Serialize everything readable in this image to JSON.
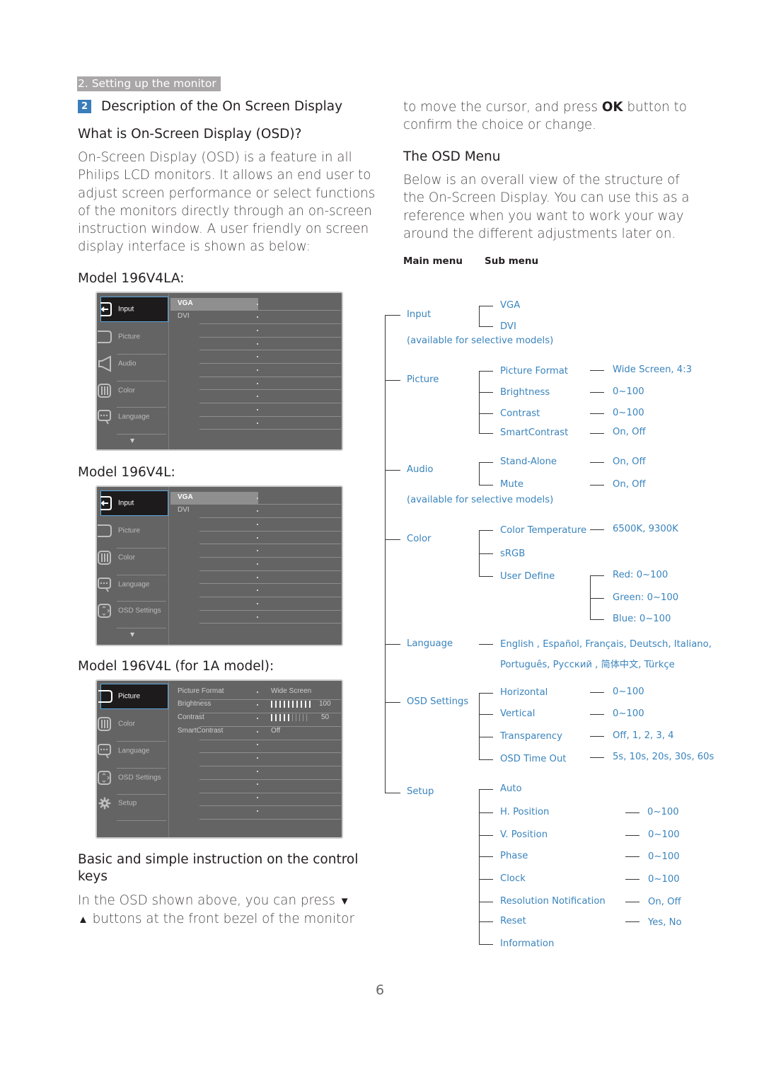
{
  "header": {
    "section_tag": "2. Setting up the monitor",
    "section_number": "2",
    "section_title": "Description of the On Screen Display"
  },
  "left": {
    "what_is_title": "What is On-Screen Display (OSD)?",
    "intro_lines": [
      "On-Screen Display (OSD) is a feature in all",
      "Philips LCD monitors. It allows an end user to",
      "adjust screen performance or select functions",
      "of the monitors directly through an on-screen",
      "instruction window. A user friendly on screen",
      "display interface is shown as below:"
    ],
    "models": [
      {
        "title": "Model 196V4LA:",
        "menu": [
          {
            "label": "Input",
            "icon": "input-icon",
            "active": true
          },
          {
            "label": "Picture",
            "icon": "picture-icon",
            "active": false
          },
          {
            "label": "Audio",
            "icon": "audio-icon",
            "active": false
          },
          {
            "label": "Color",
            "icon": "color-icon",
            "active": false
          },
          {
            "label": "Language",
            "icon": "language-icon",
            "active": false
          }
        ],
        "submenu": [
          "VGA",
          "DVI"
        ],
        "selected_sub": "VGA",
        "more_indicator": "▼"
      },
      {
        "title": "Model 196V4L:",
        "menu": [
          {
            "label": "Input",
            "icon": "input-icon",
            "active": true
          },
          {
            "label": "Picture",
            "icon": "picture-icon",
            "active": false
          },
          {
            "label": "Color",
            "icon": "color-icon",
            "active": false
          },
          {
            "label": "Language",
            "icon": "language-icon",
            "active": false
          },
          {
            "label": "OSD Settings",
            "icon": "osd-settings-icon",
            "active": false
          }
        ],
        "submenu": [
          "VGA",
          "DVI"
        ],
        "selected_sub": "VGA",
        "more_indicator": "▼"
      },
      {
        "title": "Model 196V4L (for 1A model):",
        "menu": [
          {
            "label": "Picture",
            "icon": "picture-icon",
            "active": true
          },
          {
            "label": "Color",
            "icon": "color-icon",
            "active": false
          },
          {
            "label": "Language",
            "icon": "language-icon",
            "active": false
          },
          {
            "label": "OSD Settings",
            "icon": "osd-settings-icon",
            "active": false
          },
          {
            "label": "Setup",
            "icon": "gear-icon",
            "active": false
          }
        ],
        "settings": [
          {
            "label": "Picture Format",
            "value": "Wide Screen"
          },
          {
            "label": "Brightness",
            "value": "100",
            "level": 1.0
          },
          {
            "label": "Contrast",
            "value": "50",
            "level": 0.5
          },
          {
            "label": "SmartContrast",
            "value": "Off"
          }
        ]
      }
    ],
    "control_keys_title_l1": "Basic and simple instruction on the control",
    "control_keys_title_l2": "keys",
    "control_keys_l1": "In the OSD shown above, you can press",
    "control_keys_l2": "buttons at the front bezel of the monitor",
    "down_symbol": "▼",
    "up_symbol": "▲"
  },
  "right": {
    "continue_l1_pre": "to move the cursor, and press ",
    "continue_l1_bold": "OK",
    "continue_l1_post": " button to",
    "continue_l2": "confirm the choice or change.",
    "osd_menu_title": "The OSD Menu",
    "osd_menu_lines": [
      "Below is an overall view of the structure of",
      "the On-Screen Display. You can use this as a",
      "reference when you want to work your way",
      "around the different adjustments later on."
    ],
    "col_main": "Main menu",
    "col_sub": "Sub menu",
    "tree": {
      "input": {
        "label": "Input",
        "subs": [
          "VGA",
          "DVI"
        ],
        "note": "(available for selective models)"
      },
      "picture": {
        "label": "Picture",
        "subs": [
          {
            "label": "Picture Format",
            "value": "Wide Screen, 4:3"
          },
          {
            "label": "Brightness",
            "value": "0~100"
          },
          {
            "label": "Contrast",
            "value": "0~100"
          },
          {
            "label": "SmartContrast",
            "value": "On, Off"
          }
        ]
      },
      "audio": {
        "label": "Audio",
        "subs": [
          {
            "label": "Stand-Alone",
            "value": "On, Off"
          },
          {
            "label": "Mute",
            "value": "On, Off"
          }
        ],
        "note": "(available for selective models)"
      },
      "color": {
        "label": "Color",
        "subs": [
          {
            "label": "Color Temperature",
            "value": "6500K, 9300K"
          },
          {
            "label": "sRGB"
          },
          {
            "label": "User Define",
            "values": [
              "Red: 0~100",
              "Green: 0~100",
              "Blue: 0~100"
            ]
          }
        ]
      },
      "language": {
        "label": "Language",
        "line1": "English , Español, Français, Deutsch, Italiano,",
        "line2": "Português, Русский , 简体中文, Türkçe"
      },
      "osd_settings": {
        "label": "OSD Settings",
        "subs": [
          {
            "label": "Horizontal",
            "value": "0~100"
          },
          {
            "label": "Vertical",
            "value": "0~100"
          },
          {
            "label": "Transparency",
            "value": "Off, 1, 2, 3, 4"
          },
          {
            "label": "OSD Time Out",
            "value": "5s, 10s, 20s, 30s, 60s"
          }
        ]
      },
      "setup": {
        "label": "Setup",
        "subs": [
          {
            "label": "Auto"
          },
          {
            "label": "H. Position",
            "value": "0~100"
          },
          {
            "label": "V. Position",
            "value": "0~100"
          },
          {
            "label": "Phase",
            "value": "0~100"
          },
          {
            "label": "Clock",
            "value": "0~100"
          },
          {
            "label": "Resolution Notification",
            "value": "On, Off"
          },
          {
            "label": "Reset",
            "value": "Yes, No"
          },
          {
            "label": "Information"
          }
        ]
      }
    }
  },
  "footer": {
    "page_number": "6"
  },
  "colors": {
    "accent_blue": "#3a84bd",
    "badge_blue": "#3a7dba",
    "tag_gray": "#a9a7a7",
    "osd_bg": "#646464"
  }
}
